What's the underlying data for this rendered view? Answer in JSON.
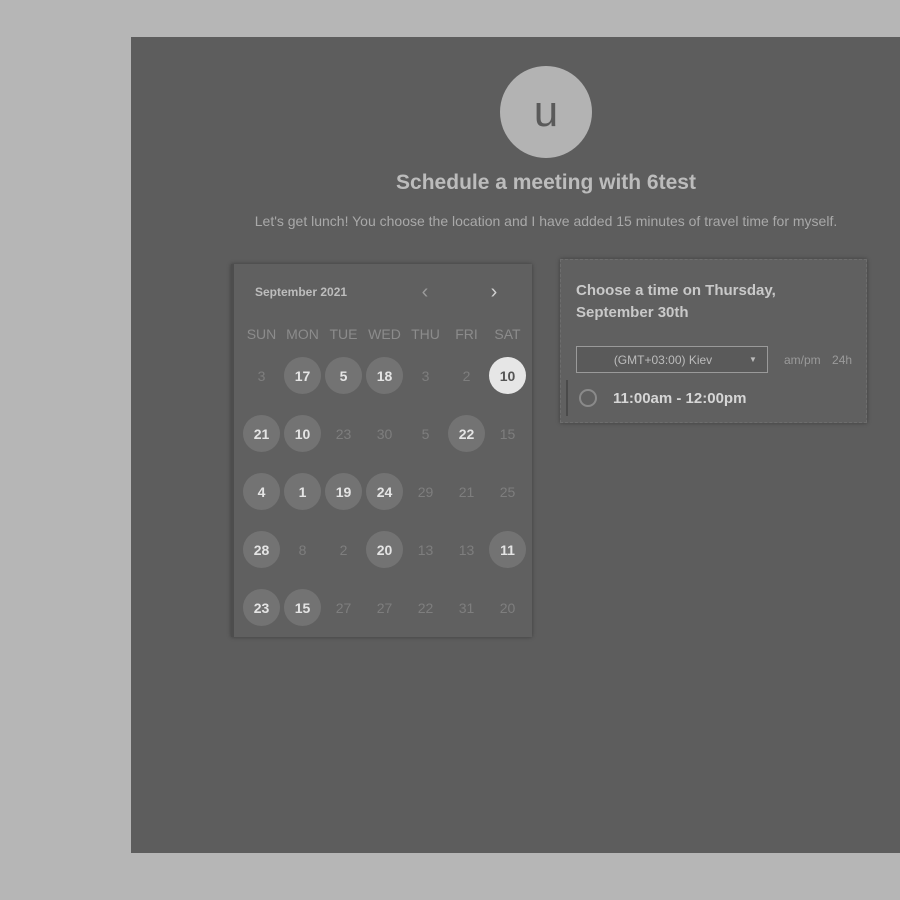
{
  "profile": {
    "avatar_letter": "u"
  },
  "header": {
    "title": "Schedule a meeting with 6test",
    "description": "Let's get lunch! You choose the location and I have added 15 minutes of travel time for myself."
  },
  "calendar": {
    "month_label": "September 2021",
    "prev_icon": "chevron-left-icon",
    "next_icon": "chevron-right-icon",
    "weekdays": [
      "SUN",
      "MON",
      "TUE",
      "WED",
      "THU",
      "FRI",
      "SAT"
    ],
    "days": [
      {
        "label": "3",
        "state": "off"
      },
      {
        "label": "17",
        "state": "avail"
      },
      {
        "label": "5",
        "state": "avail"
      },
      {
        "label": "18",
        "state": "avail"
      },
      {
        "label": "3",
        "state": "off"
      },
      {
        "label": "2",
        "state": "off"
      },
      {
        "label": "10",
        "state": "selected"
      },
      {
        "label": "21",
        "state": "avail"
      },
      {
        "label": "10",
        "state": "avail"
      },
      {
        "label": "23",
        "state": "off"
      },
      {
        "label": "30",
        "state": "off"
      },
      {
        "label": "5",
        "state": "off"
      },
      {
        "label": "22",
        "state": "avail"
      },
      {
        "label": "15",
        "state": "off"
      },
      {
        "label": "4",
        "state": "avail"
      },
      {
        "label": "1",
        "state": "avail"
      },
      {
        "label": "19",
        "state": "avail"
      },
      {
        "label": "24",
        "state": "avail"
      },
      {
        "label": "29",
        "state": "off"
      },
      {
        "label": "21",
        "state": "off"
      },
      {
        "label": "25",
        "state": "off"
      },
      {
        "label": "28",
        "state": "avail"
      },
      {
        "label": "8",
        "state": "off"
      },
      {
        "label": "2",
        "state": "off"
      },
      {
        "label": "20",
        "state": "avail"
      },
      {
        "label": "13",
        "state": "off"
      },
      {
        "label": "13",
        "state": "off"
      },
      {
        "label": "11",
        "state": "avail"
      },
      {
        "label": "23",
        "state": "avail"
      },
      {
        "label": "15",
        "state": "avail"
      },
      {
        "label": "27",
        "state": "off"
      },
      {
        "label": "27",
        "state": "off"
      },
      {
        "label": "22",
        "state": "off"
      },
      {
        "label": "31",
        "state": "off"
      },
      {
        "label": "20",
        "state": "off"
      }
    ]
  },
  "time_picker": {
    "heading": "Choose a time on Thursday, September 30th",
    "timezone": "(GMT+03:00) Kiev",
    "format_ampm": "am/pm",
    "format_24h": "24h",
    "slots": [
      {
        "label": "11:00am - 12:00pm"
      }
    ]
  }
}
